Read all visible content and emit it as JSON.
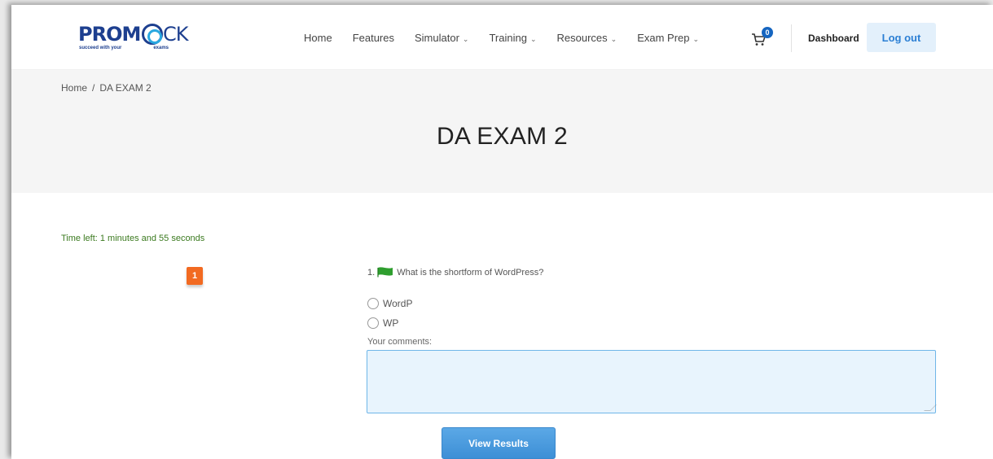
{
  "brand": {
    "logo_prefix": "PROM",
    "logo_suffix": "CK",
    "tagline_left": "succeed with your",
    "tagline_right": "exams"
  },
  "nav": {
    "items": [
      {
        "label": "Home",
        "has_dropdown": false
      },
      {
        "label": "Features",
        "has_dropdown": false
      },
      {
        "label": "Simulator",
        "has_dropdown": true
      },
      {
        "label": "Training",
        "has_dropdown": true
      },
      {
        "label": "Resources",
        "has_dropdown": true
      },
      {
        "label": "Exam Prep",
        "has_dropdown": true
      }
    ],
    "cart_count": "0",
    "dashboard_label": "Dashboard",
    "logout_label": "Log out"
  },
  "breadcrumb": {
    "home": "Home",
    "separator": "/",
    "current": "DA EXAM 2"
  },
  "page_title": "DA EXAM 2",
  "quiz": {
    "timer_text": "Time left: 1 minutes and 55 seconds",
    "question_marker": "1",
    "question_number": "1.",
    "question_text": "What is the shortform of WordPress?",
    "options": [
      "WordP",
      "WP"
    ],
    "comments_label": "Your comments:",
    "comments_value": "",
    "submit_label": "View Results"
  },
  "colors": {
    "brand_blue": "#1d3f8f",
    "accent_blue": "#29a8e0",
    "marker_orange": "#f26a21",
    "timer_green": "#3b7a1f",
    "flag_green": "#2e9e2e",
    "button_blue": "#3d8fd6"
  }
}
